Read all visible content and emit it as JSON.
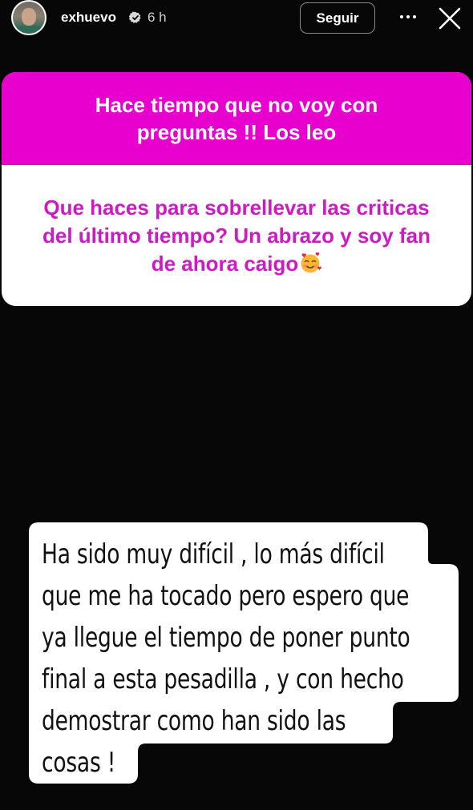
{
  "header": {
    "username": "exhuevo",
    "time_ago": "6 h",
    "follow_label": "Seguir",
    "verified_icon": "verified-badge-icon",
    "more_icon": "more-dots-icon",
    "close_icon": "close-icon"
  },
  "question": {
    "prompt_lines": [
      "Hace tiempo que no voy con",
      "preguntas !! Los leo"
    ],
    "text_lines": [
      "Que haces para sobrellevar las criticas",
      "del último tiempo? Un abrazo y soy fan",
      "de ahora caigo"
    ],
    "emoji_icon": "smiling-face-with-hearts-icon",
    "colors": {
      "accent": "#e800cf",
      "text": "#cf19c4"
    }
  },
  "answer": {
    "lines": [
      "Ha sido muy difícil , lo más difícil",
      "que me ha tocado pero espero que",
      "ya llegue el tiempo de poner punto",
      "final a esta pesadilla , y con hecho",
      "demostrar como han sido las",
      "cosas !"
    ]
  }
}
